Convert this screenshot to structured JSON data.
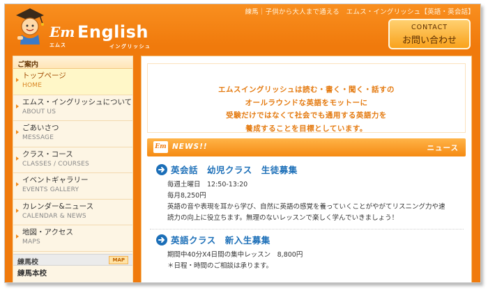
{
  "header": {
    "tagline": "練馬｜子供から大人まで通える　エムス・イングリッシュ【英語・英会話】",
    "logo_mark": "Em",
    "logo_mark_kana": "エムス",
    "logo_word": "English",
    "logo_kana": "イングリッシュ",
    "contact_en": "CONTACT",
    "contact_jp": "お問い合わせ"
  },
  "sidebar": {
    "heading": "ご案内",
    "items": [
      {
        "jp": "トップページ",
        "en": "HOME"
      },
      {
        "jp": "エムス・イングリッシュについて",
        "en": "ABOUT US"
      },
      {
        "jp": "ごあいさつ",
        "en": "MESSAGE"
      },
      {
        "jp": "クラス・コース",
        "en": "CLASSES / COURSES"
      },
      {
        "jp": "イベントギャラリー",
        "en": "EVENTS GALLERY"
      },
      {
        "jp": "カレンダー&ニュース",
        "en": "CALENDAR & NEWS"
      },
      {
        "jp": "地図・アクセス",
        "en": "MAPS"
      }
    ],
    "school_heading": "練馬校",
    "map_badge": "MAP",
    "school_name": "練馬本校"
  },
  "intro": {
    "lines": [
      "エムスイングリッシュは読む・書く・聞く・話すの",
      "オールラウンドな英語をモットーに",
      "受験だけではなくて社会でも通用する英語力を",
      "養成することを目標としています。"
    ]
  },
  "news": {
    "mark": "Em",
    "title": "NEWS!!",
    "title_jp": "ニュース",
    "items": [
      {
        "title": "英会話　幼児クラス　生徒募集",
        "lines": [
          "毎週土曜日　12:50-13:20",
          "毎月8,250円",
          "英語の音や表現を耳から学び、自然に英語の感覚を養っていくことがやがてリスニング力や速",
          "読力の向上に役立ちます。無理のないレッスンで楽しく学んでいきましょう！"
        ]
      },
      {
        "title": "英語クラス　新入生募集",
        "lines": [
          "期間中40分X4日間の集中レッスン　8,800円",
          "＊日程・時間のご相談は承ります。"
        ]
      }
    ]
  },
  "colors": {
    "brand_orange": "#f07a0c",
    "accent_blue": "#1c6fb8"
  }
}
